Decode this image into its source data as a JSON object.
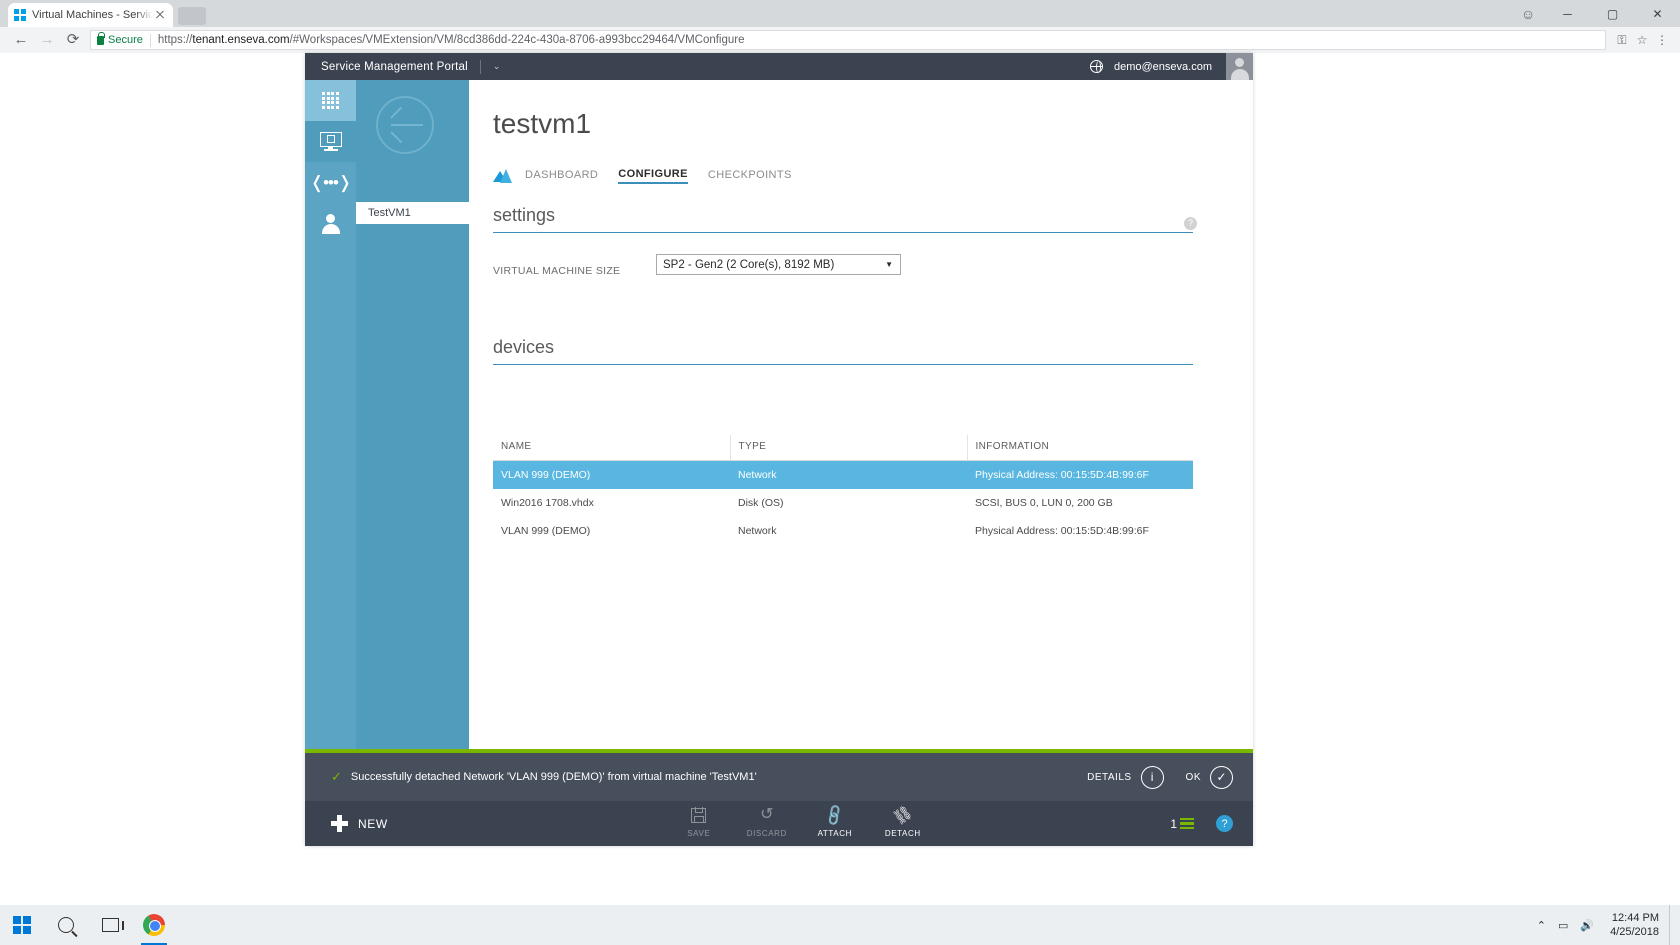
{
  "browser": {
    "tab_title": "Virtual Machines - Servic",
    "favicon": "windows-logo-icon",
    "new_tab_label": "",
    "back_label": "←",
    "forward_label": "→",
    "reload_label": "⟳",
    "secure_label": "Secure",
    "url_scheme": "https://",
    "url_host": "tenant.enseva.com",
    "url_path": "/#Workspaces/VMExtension/VM/8cd386dd-224c-430a-8706-a993bcc29464/VMConfigure",
    "key_icon": "⚿",
    "star_icon": "☆",
    "menu_icon": "⋮",
    "profile_icon": "☺",
    "minimize_label": "─",
    "maximize_label": "▢",
    "close_label": "✕"
  },
  "portal": {
    "brand": "Service Management Portal",
    "brand_caret": "⌄",
    "user_email": "demo@enseva.com",
    "globe_icon": "globe-icon",
    "avatar_icon": "user-avatar-icon"
  },
  "rail": {
    "items": [
      {
        "name": "all-items",
        "icon": "grid-icon",
        "active": true
      },
      {
        "name": "virtual-machines",
        "icon": "vm-monitor-icon",
        "active": false
      },
      {
        "name": "networks",
        "icon": "network-icon",
        "glyph": "❬•••❭"
      },
      {
        "name": "user-accounts",
        "icon": "user-icon"
      }
    ]
  },
  "nav": {
    "back_label": "back-arrow-icon",
    "entry_label": "TestVM1"
  },
  "page": {
    "vm_name": "testvm1",
    "tabs": [
      {
        "label": "DASHBOARD",
        "active": false
      },
      {
        "label": "CONFIGURE",
        "active": true
      },
      {
        "label": "CHECKPOINTS",
        "active": false
      }
    ],
    "settings": {
      "heading": "settings",
      "help_glyph": "?",
      "vm_size_label": "VIRTUAL MACHINE SIZE",
      "vm_size_value": "SP2 - Gen2 (2 Core(s), 8192 MB)",
      "select_arrow": "▼"
    },
    "devices": {
      "heading": "devices",
      "columns": [
        "NAME",
        "TYPE",
        "INFORMATION"
      ],
      "rows": [
        {
          "name": "VLAN 999 (DEMO)",
          "type": "Network",
          "information": "Physical Address: 00:15:5D:4B:99:6F",
          "selected": true
        },
        {
          "name": "Win2016 1708.vhdx",
          "type": "Disk (OS)",
          "information": "SCSI, BUS 0, LUN 0, 200 GB",
          "selected": false
        },
        {
          "name": "VLAN 999 (DEMO)",
          "type": "Network",
          "information": "Physical Address: 00:15:5D:4B:99:6F",
          "selected": false
        }
      ]
    }
  },
  "notification": {
    "status_icon": "check-icon",
    "message": "Successfully detached Network 'VLAN 999 (DEMO)' from virtual machine 'TestVM1'",
    "details_label": "DETAILS",
    "details_glyph": "i",
    "ok_label": "OK",
    "ok_glyph": "✓",
    "accent_color": "#7ab800"
  },
  "commandbar": {
    "new_label": "NEW",
    "buttons": [
      {
        "label": "SAVE",
        "icon": "save-icon",
        "disabled": true
      },
      {
        "label": "DISCARD",
        "icon": "discard-icon",
        "glyph": "↺",
        "disabled": true
      },
      {
        "label": "ATTACH",
        "icon": "attach-link-icon",
        "glyph": "🔗",
        "disabled": false
      },
      {
        "label": "DETACH",
        "icon": "detach-broken-link-icon",
        "glyph": "⛓",
        "disabled": false
      }
    ],
    "notification_count": "1",
    "help_glyph": "?"
  },
  "taskbar": {
    "start_icon": "windows-start-icon",
    "search_icon": "search-icon",
    "taskview_icon": "task-view-icon",
    "chrome_icon": "chrome-icon",
    "tray_chevron": "⌃",
    "tray_network": "network-tray-icon",
    "tray_volume": "volume-tray-icon",
    "time": "12:44 PM",
    "date": "4/25/2018"
  }
}
